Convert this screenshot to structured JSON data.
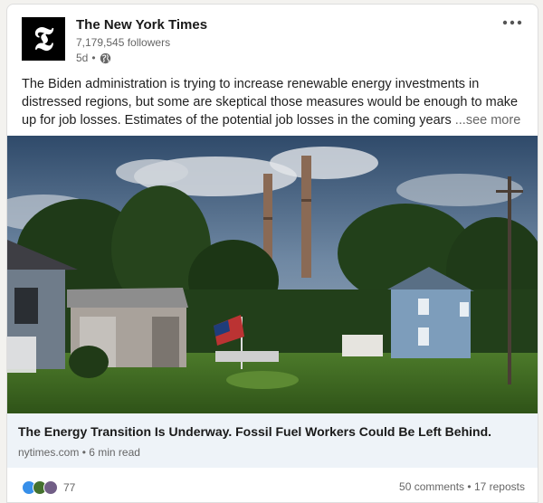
{
  "author": {
    "logo_glyph": "𝕿",
    "name": "The New York Times",
    "followers": "7,179,545 followers",
    "age": "5d",
    "separator": "•",
    "visibility_icon": "globe-icon"
  },
  "menu": {
    "more_label": "•••"
  },
  "post": {
    "text": "The Biden administration is trying to increase renewable energy investments in distressed regions, but some are skeptical those measures would be enough to make up for job losses. Estimates of the potential job losses in the coming years",
    "see_more": "...see more"
  },
  "article": {
    "title": "The Energy Transition Is Underway. Fossil Fuel Workers Could Be Left Behind.",
    "source": "nytimes.com",
    "separator": "•",
    "read_time": "6 min read"
  },
  "social": {
    "reaction_count": "77",
    "comments": "50 comments",
    "separator": "•",
    "reposts": "17 reposts"
  },
  "colors": {
    "link_bar_bg": "#eef3f8",
    "muted_text": "#666666",
    "like_blue": "#378fe9",
    "celebrate_green": "#44712e",
    "support_purple": "#715e86"
  }
}
